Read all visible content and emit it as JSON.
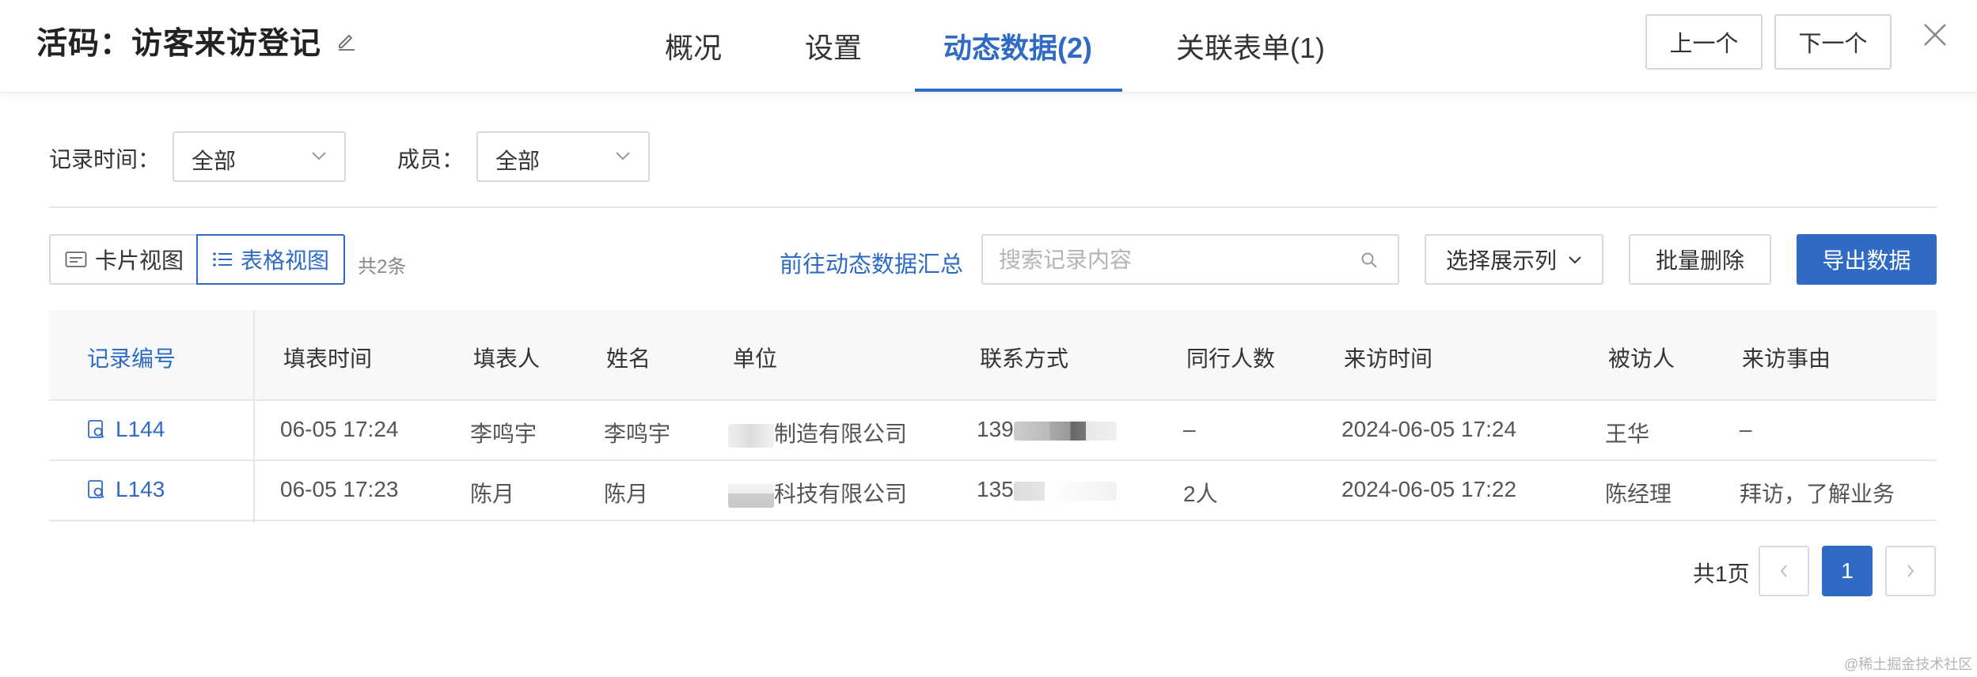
{
  "header": {
    "title": "活码：访客来访登记",
    "tabs": [
      {
        "label": "概况",
        "active": false
      },
      {
        "label": "设置",
        "active": false
      },
      {
        "label": "动态数据(2)",
        "active": true
      },
      {
        "label": "关联表单(1)",
        "active": false
      }
    ],
    "prev_label": "上一个",
    "next_label": "下一个"
  },
  "filters": {
    "time_label": "记录时间：",
    "time_value": "全部",
    "member_label": "成员：",
    "member_value": "全部"
  },
  "toolbar": {
    "card_view_label": "卡片视图",
    "table_view_label": "表格视图",
    "total_text": "共2条",
    "goto_summary_label": "前往动态数据汇总",
    "search_placeholder": "搜索记录内容",
    "select_columns_label": "选择展示列",
    "batch_delete_label": "批量删除",
    "export_label": "导出数据"
  },
  "table": {
    "columns": [
      "记录编号",
      "填表时间",
      "填表人",
      "姓名",
      "单位",
      "联系方式",
      "同行人数",
      "来访时间",
      "被访人",
      "来访事由"
    ],
    "rows": [
      {
        "code": "L144",
        "fill_time": "06-05 17:24",
        "filler": "李鸣宇",
        "name": "李鸣宇",
        "company": "制造有限公司",
        "phone": "139",
        "companions": "–",
        "visit_time": "2024-06-05 17:24",
        "visitee": "王华",
        "reason": "–"
      },
      {
        "code": "L143",
        "fill_time": "06-05 17:23",
        "filler": "陈月",
        "name": "陈月",
        "company": "科技有限公司",
        "phone": "135",
        "companions": "2人",
        "visit_time": "2024-06-05 17:22",
        "visitee": "陈经理",
        "reason": "拜访，了解业务"
      }
    ]
  },
  "pagination": {
    "total_pages_text": "共1页",
    "current_page": "1",
    "prev_symbol": "<",
    "next_symbol": ">"
  },
  "watermark": "@稀土掘金技术社区",
  "colors": {
    "accent": "#2f6bc5",
    "border": "#d9d9d9",
    "header_bg": "#f7f8fa"
  }
}
